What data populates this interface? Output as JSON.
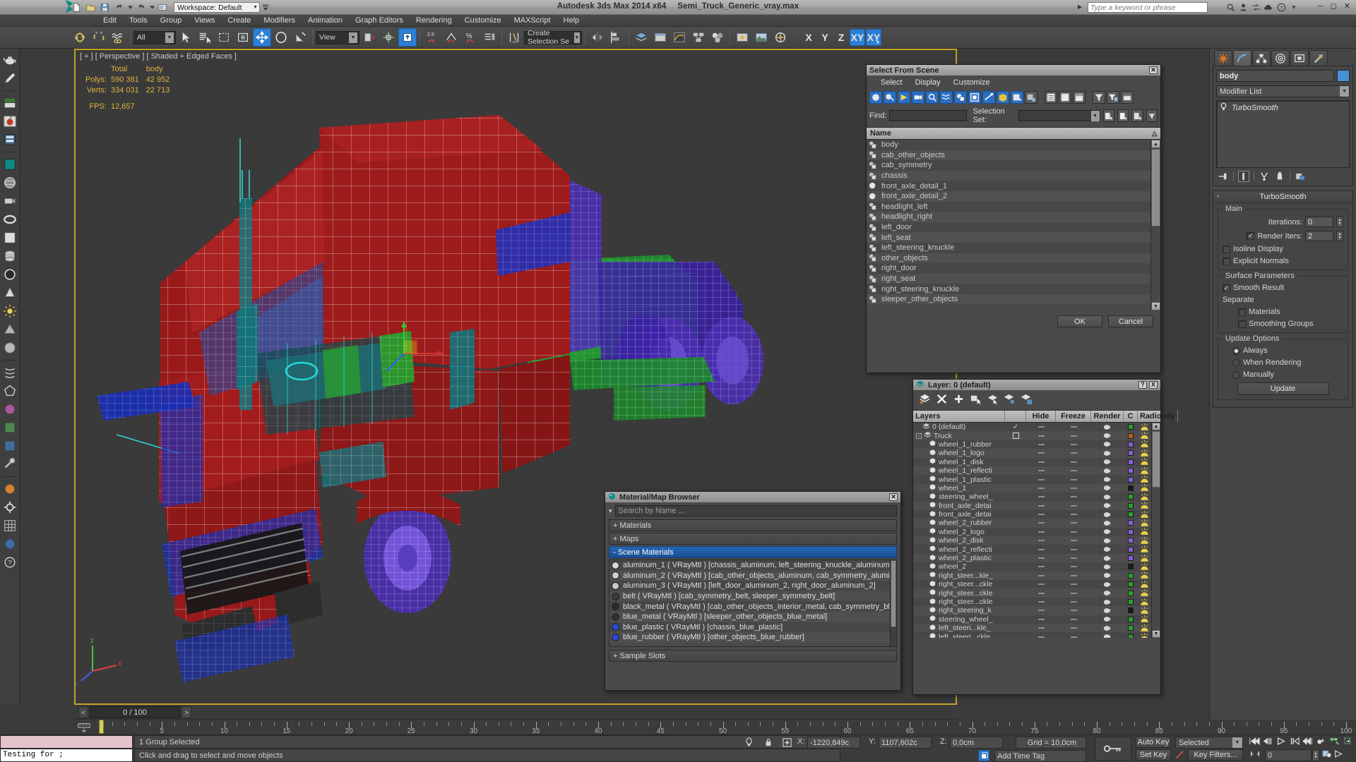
{
  "app": {
    "title": "Autodesk 3ds Max  2014 x64",
    "filename": "Semi_Truck_Generic_vray.max",
    "workspace": "Workspace: Default",
    "search_placeholder": "Type a keyword or phrase"
  },
  "menubar": {
    "items": [
      "Edit",
      "Tools",
      "Group",
      "Views",
      "Create",
      "Modifiers",
      "Animation",
      "Graph Editors",
      "Rendering",
      "Customize",
      "MAXScript",
      "Help"
    ]
  },
  "toolbar": {
    "selection_filter": "All",
    "ref_coord_system": "View",
    "named_selection_set": "Create Selection Se",
    "axis_x": "X",
    "axis_y": "Y",
    "axis_z": "Z",
    "axis_xy": "XY",
    "axis_xy2": "XY"
  },
  "viewport": {
    "label": "[ + ] [ Perspective ] [ Shaded + Edged Faces ]",
    "stats": {
      "col_total": "Total",
      "col_object": "body",
      "polys_label": "Polys:",
      "polys_total": "590 381",
      "polys_object": "42 952",
      "verts_label": "Verts:",
      "verts_total": "334 031",
      "verts_object": "22 713",
      "fps_label": "FPS:",
      "fps_value": "12,657"
    }
  },
  "select_from_scene": {
    "title": "Select From Scene",
    "menu": [
      "Select",
      "Display",
      "Customize"
    ],
    "find_label": "Find:",
    "find_value": "",
    "selection_set_label": "Selection Set:",
    "selection_set_value": "",
    "column_name": "Name",
    "objects": [
      {
        "name": "body",
        "type": "group"
      },
      {
        "name": "cab_other_objects",
        "type": "group"
      },
      {
        "name": "cab_symmetry",
        "type": "group"
      },
      {
        "name": "chassis",
        "type": "group"
      },
      {
        "name": "front_axle_detail_1",
        "type": "geom"
      },
      {
        "name": "front_axle_detail_2",
        "type": "geom"
      },
      {
        "name": "headlight_left",
        "type": "group"
      },
      {
        "name": "headlight_right",
        "type": "group"
      },
      {
        "name": "left_door",
        "type": "group"
      },
      {
        "name": "left_seat",
        "type": "group"
      },
      {
        "name": "left_steering_knuckle",
        "type": "group"
      },
      {
        "name": "other_objects",
        "type": "group"
      },
      {
        "name": "right_door",
        "type": "group"
      },
      {
        "name": "right_seat",
        "type": "group"
      },
      {
        "name": "right_steering_knuckle",
        "type": "group"
      },
      {
        "name": "sleeper_other_objects",
        "type": "group"
      }
    ],
    "ok_label": "OK",
    "cancel_label": "Cancel"
  },
  "material_browser": {
    "title": "Material/Map Browser",
    "search_placeholder": "Search by Name ...",
    "groups": [
      {
        "label": "+ Materials",
        "expanded": false
      },
      {
        "label": "+ Maps",
        "expanded": false
      },
      {
        "label": "- Scene Materials",
        "expanded": true
      }
    ],
    "sample_slots_label": "+ Sample Slots",
    "materials": [
      {
        "name": "aluminum_1",
        "type": "( VRayMtl )",
        "assigned": "[chassis_aluminum, left_steering_knuckle_aluminum, r...",
        "color": "#d8d8d8"
      },
      {
        "name": "aluminum_2",
        "type": "( VRayMtl )",
        "assigned": "[cab_other_objects_aluminum, cab_symmetry_alumin...",
        "color": "#d0d0d0"
      },
      {
        "name": "aluminum_3",
        "type": "( VRayMtl )",
        "assigned": "[left_door_aluminum_2, right_door_aluminum_2]",
        "color": "#c9c9c9"
      },
      {
        "name": "belt",
        "type": "( VRayMtl )",
        "assigned": "[cab_symmetry_belt, sleeper_symmetry_belt]",
        "color": "#3a3a3a"
      },
      {
        "name": "black_metal",
        "type": "( VRayMtl )",
        "assigned": "[cab_other_objects_interior_metal, cab_symmetry_blac...",
        "color": "#2a2a2a"
      },
      {
        "name": "blue_metal",
        "type": "( VRayMtl )",
        "assigned": "[sleeper_other_objects_blue_metal]",
        "color": "#303030"
      },
      {
        "name": "blue_plastic",
        "type": "( VRayMtl )",
        "assigned": "[chassis_blue_plastic]",
        "color": "#2a49d0"
      },
      {
        "name": "blue_rubber",
        "type": "( VRayMtl )",
        "assigned": "[other_objects_blue_rubber]",
        "color": "#2a49d0"
      }
    ]
  },
  "layer_manager": {
    "title": "Layer: 0 (default)",
    "help_label": "?",
    "close_label": "X",
    "columns": [
      "Layers",
      "",
      "Hide",
      "Freeze",
      "Render",
      "C",
      "Radiosity"
    ],
    "rows": [
      {
        "name": "0 (default)",
        "indent": 1,
        "kind": "layer",
        "current": "check",
        "color": "#2aa02a"
      },
      {
        "name": "Truck",
        "indent": 0,
        "kind": "layer-expand",
        "current": "box",
        "color": "#c0601a"
      },
      {
        "name": "wheel_1_rubber",
        "indent": 2,
        "kind": "obj",
        "color": "#8a5ce0"
      },
      {
        "name": "wheel_1_logo",
        "indent": 2,
        "kind": "obj",
        "color": "#8a5ce0"
      },
      {
        "name": "wheel_1_disk",
        "indent": 2,
        "kind": "obj",
        "color": "#8a5ce0"
      },
      {
        "name": "wheel_1_reflecti",
        "indent": 2,
        "kind": "obj",
        "color": "#8a5ce0"
      },
      {
        "name": "wheel_1_plastic",
        "indent": 2,
        "kind": "obj",
        "color": "#8a5ce0"
      },
      {
        "name": "wheel_1",
        "indent": 2,
        "kind": "obj",
        "color": "#1a1a1a"
      },
      {
        "name": "steering_wheel_",
        "indent": 2,
        "kind": "obj",
        "color": "#2aa02a"
      },
      {
        "name": "front_axle_detai",
        "indent": 2,
        "kind": "obj",
        "color": "#2aa02a"
      },
      {
        "name": "front_axle_detai",
        "indent": 2,
        "kind": "obj",
        "color": "#2aa02a"
      },
      {
        "name": "wheel_2_rubber",
        "indent": 2,
        "kind": "obj",
        "color": "#8a5ce0"
      },
      {
        "name": "wheel_2_logo",
        "indent": 2,
        "kind": "obj",
        "color": "#8a5ce0"
      },
      {
        "name": "wheel_2_disk",
        "indent": 2,
        "kind": "obj",
        "color": "#8a5ce0"
      },
      {
        "name": "wheel_2_reflecti",
        "indent": 2,
        "kind": "obj",
        "color": "#8a5ce0"
      },
      {
        "name": "wheel_2_plastic",
        "indent": 2,
        "kind": "obj",
        "color": "#8a5ce0"
      },
      {
        "name": "wheel_2",
        "indent": 2,
        "kind": "obj",
        "color": "#1a1a1a"
      },
      {
        "name": "right_steer...kle_",
        "indent": 2,
        "kind": "obj",
        "color": "#2aa02a"
      },
      {
        "name": "right_steer...ckle",
        "indent": 2,
        "kind": "obj",
        "color": "#2aa02a"
      },
      {
        "name": "right_steer...ckle",
        "indent": 2,
        "kind": "obj",
        "color": "#2aa02a"
      },
      {
        "name": "right_steer...ckle",
        "indent": 2,
        "kind": "obj",
        "color": "#2aa02a"
      },
      {
        "name": "right_steering_k",
        "indent": 2,
        "kind": "obj",
        "color": "#1a1a1a"
      },
      {
        "name": "steering_wheel_",
        "indent": 2,
        "kind": "obj",
        "color": "#2aa02a"
      },
      {
        "name": "left_steeri...kle_",
        "indent": 2,
        "kind": "obj",
        "color": "#2aa02a"
      },
      {
        "name": "left_steeri...ckle",
        "indent": 2,
        "kind": "obj",
        "color": "#2aa02a"
      }
    ]
  },
  "command_panel": {
    "object_name": "body",
    "object_color": "#4a90d9",
    "modifier_list_label": "Modifier List",
    "modifiers": [
      "TurboSmooth"
    ],
    "turbosmooth": {
      "rollout_title": "TurboSmooth",
      "main_group": "Main",
      "iterations_label": "Iterations:",
      "iterations_value": "0",
      "render_iters_label": "Render Iters:",
      "render_iters_value": "2",
      "render_iters_checked": true,
      "isoline_label": "Isoline Display",
      "isoline_checked": false,
      "explicit_normals_label": "Explicit Normals",
      "explicit_normals_checked": false,
      "surface_group": "Surface Parameters",
      "smooth_result_label": "Smooth Result",
      "smooth_result_checked": true,
      "separate_label": "Separate",
      "materials_label": "Materials",
      "materials_checked": false,
      "smoothing_groups_label": "Smoothing Groups",
      "smoothing_groups_checked": false,
      "update_group": "Update Options",
      "always_label": "Always",
      "when_rendering_label": "When Rendering",
      "manually_label": "Manually",
      "update_button": "Update",
      "update_selected": "Always"
    }
  },
  "timeline": {
    "current_frame_display": "0 / 100",
    "prev_label": "<",
    "next_label": ">",
    "ticks": [
      0,
      5,
      10,
      15,
      20,
      25,
      30,
      35,
      40,
      45,
      50,
      55,
      60,
      65,
      70,
      75,
      80,
      85,
      90,
      95,
      100
    ]
  },
  "statusbar": {
    "maxscript_listener_text": "Testing for ;",
    "selection_status": "1 Group Selected",
    "prompt": "Click and drag to select and move objects",
    "x_label": "X:",
    "x_value": "-1220,849c",
    "y_label": "Y:",
    "y_value": "1107,602c",
    "z_label": "Z:",
    "z_value": "0,0cm",
    "grid_label": "Grid = 10,0cm",
    "add_time_tag": "Add Time Tag",
    "auto_key": "Auto Key",
    "set_key": "Set Key",
    "key_mode": "Selected",
    "key_filters": "Key Filters...",
    "frame_field": "0"
  }
}
